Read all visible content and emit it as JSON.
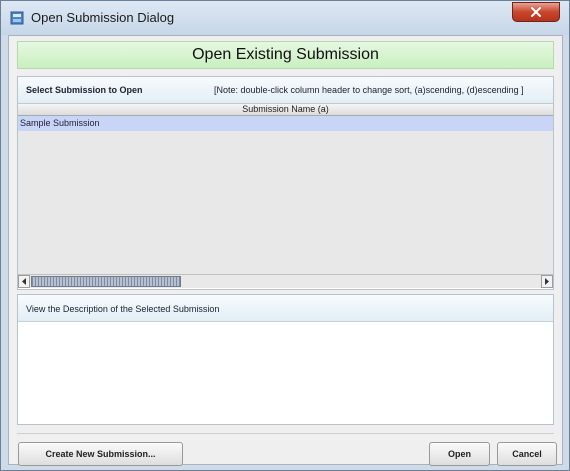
{
  "window": {
    "title": "Open Submission Dialog"
  },
  "banner": {
    "title": "Open Existing Submission"
  },
  "select_panel": {
    "label": "Select Submission to Open",
    "note": "[Note: double-click column header to change sort, (a)scending, (d)escending ]",
    "column_header": "Submission Name (a)",
    "rows": [
      "Sample Submission"
    ]
  },
  "description_panel": {
    "label": "View the Description of the Selected Submission",
    "text": ""
  },
  "buttons": {
    "create_new": "Create New Submission...",
    "open": "Open",
    "cancel": "Cancel"
  },
  "icons": {
    "app": "app-icon",
    "close": "close-icon"
  },
  "colors": {
    "banner_bg": "#c9efbf",
    "selected_row": "#c8d5f7",
    "close_button": "#c9452c"
  }
}
